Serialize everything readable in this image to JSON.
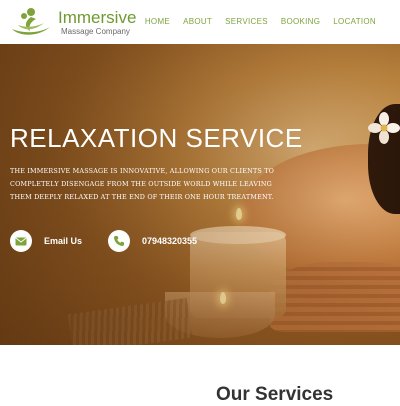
{
  "brand": {
    "name": "Immersive",
    "tagline": "Massage Company",
    "accent_color": "#7fa33b"
  },
  "nav": {
    "items": [
      {
        "label": "HOME"
      },
      {
        "label": "ABOUT"
      },
      {
        "label": "SERVICES"
      },
      {
        "label": "BOOKING"
      },
      {
        "label": "LOCATION"
      }
    ]
  },
  "hero": {
    "title": "RELAXATION SERVICE",
    "description": "THE IMMERSIVE MASSAGE IS INNOVATIVE, ALLOWING OUR CLIENTS TO COMPLETELY DISENGAGE FROM THE OUTSIDE WORLD WHILE LEAVING THEM DEEPLY RELAXED AT THE END OF THEIR ONE HOUR TREATMENT.",
    "email_label": "Email Us",
    "email_icon": "envelope-icon",
    "phone_label": "07948320355",
    "phone_icon": "phone-icon"
  },
  "services": {
    "title": "Our Services"
  }
}
